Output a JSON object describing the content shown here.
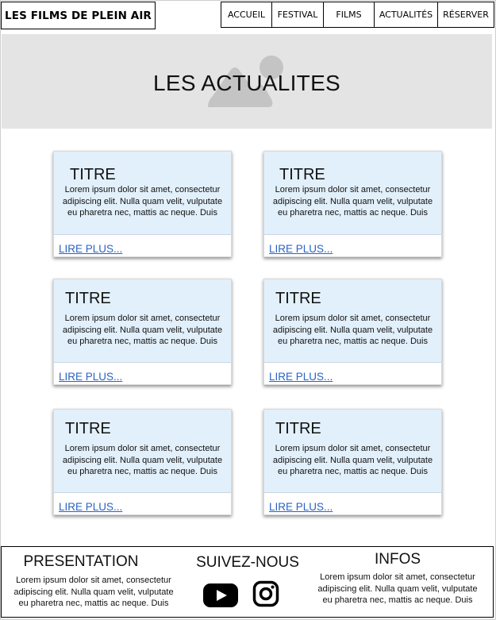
{
  "header": {
    "logo": "LES FILMS DE PLEIN AIR",
    "nav": [
      {
        "label": "ACCUEIL"
      },
      {
        "label": "FESTIVAL"
      },
      {
        "label": "FILMS"
      },
      {
        "label": "ACTUALITÉS"
      },
      {
        "label": "RÉSERVER"
      }
    ]
  },
  "hero": {
    "title": "LES ACTUALITES",
    "image_icon": "image-placeholder-icon"
  },
  "cards": [
    {
      "title": "TITRE",
      "text": "Lorem ipsum dolor sit amet, consectetur adipiscing elit. Nulla quam velit, vulputate eu pharetra nec, mattis ac neque. Duis",
      "link": "LIRE PLUS..."
    },
    {
      "title": "TITRE",
      "text": "Lorem ipsum dolor sit amet, consectetur adipiscing elit. Nulla quam velit, vulputate eu pharetra nec, mattis ac neque. Duis",
      "link": "LIRE PLUS..."
    },
    {
      "title": "TITRE",
      "text": "Lorem ipsum dolor sit amet, consectetur adipiscing elit. Nulla quam velit, vulputate eu pharetra nec, mattis ac neque. Duis",
      "link": "LIRE PLUS..."
    },
    {
      "title": "TITRE",
      "text": "Lorem ipsum dolor sit amet, consectetur adipiscing elit. Nulla quam velit, vulputate eu pharetra nec, mattis ac neque. Duis",
      "link": "LIRE PLUS..."
    },
    {
      "title": "TITRE",
      "text": "Lorem ipsum dolor sit amet, consectetur adipiscing elit. Nulla quam velit, vulputate eu pharetra nec, mattis ac neque. Duis",
      "link": "LIRE PLUS..."
    },
    {
      "title": "TITRE",
      "text": "Lorem ipsum dolor sit amet, consectetur adipiscing elit. Nulla quam velit, vulputate eu pharetra nec, mattis ac neque. Duis",
      "link": "LIRE PLUS..."
    }
  ],
  "footer": {
    "presentation": {
      "heading": "PRESENTATION",
      "text": "Lorem ipsum dolor sit amet, consectetur adipiscing elit. Nulla quam velit, vulputate eu pharetra nec, mattis ac neque. Duis"
    },
    "follow": {
      "heading": "SUIVEZ-NOUS",
      "icons": [
        "youtube-icon",
        "instagram-icon"
      ]
    },
    "infos": {
      "heading": "INFOS",
      "text": "Lorem ipsum dolor sit amet, consectetur adipiscing elit. Nulla quam velit, vulputate eu pharetra nec, mattis ac neque. Duis"
    }
  },
  "colors": {
    "hero_bg": "#e4e4e4",
    "card_top_bg": "#e2f0fb",
    "link": "#2a63c4"
  }
}
